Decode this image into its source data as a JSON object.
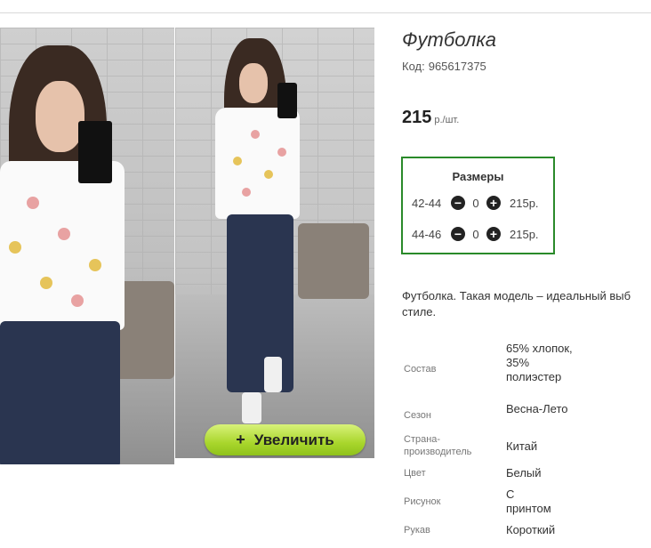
{
  "product": {
    "title": "Футболка",
    "code_label": "Код:",
    "code_value": "965617375",
    "price": "215",
    "price_unit": "р./шт."
  },
  "gallery": {
    "zoom_plus": "+",
    "zoom_label": "Увеличить"
  },
  "sizes": {
    "title": "Размеры",
    "rows": [
      {
        "size": "42-44",
        "minus": "−",
        "qty": "0",
        "plus": "+",
        "price": "215р."
      },
      {
        "size": "44-46",
        "minus": "−",
        "qty": "0",
        "plus": "+",
        "price": "215р."
      }
    ]
  },
  "description": {
    "line1": "Футболка. Такая модель – идеальный выб",
    "line2": "стиле."
  },
  "properties": [
    {
      "name": "Состав",
      "value": "65% хлопок, 35% полиэстер"
    },
    {
      "name": "Сезон",
      "value": "Весна-Лето"
    },
    {
      "name": "Страна-производитель",
      "value": "Китай"
    },
    {
      "name": "Цвет",
      "value": "Белый"
    },
    {
      "name": "Рисунок",
      "value": "С принтом"
    },
    {
      "name": "Рукав",
      "value": "Короткий"
    }
  ]
}
